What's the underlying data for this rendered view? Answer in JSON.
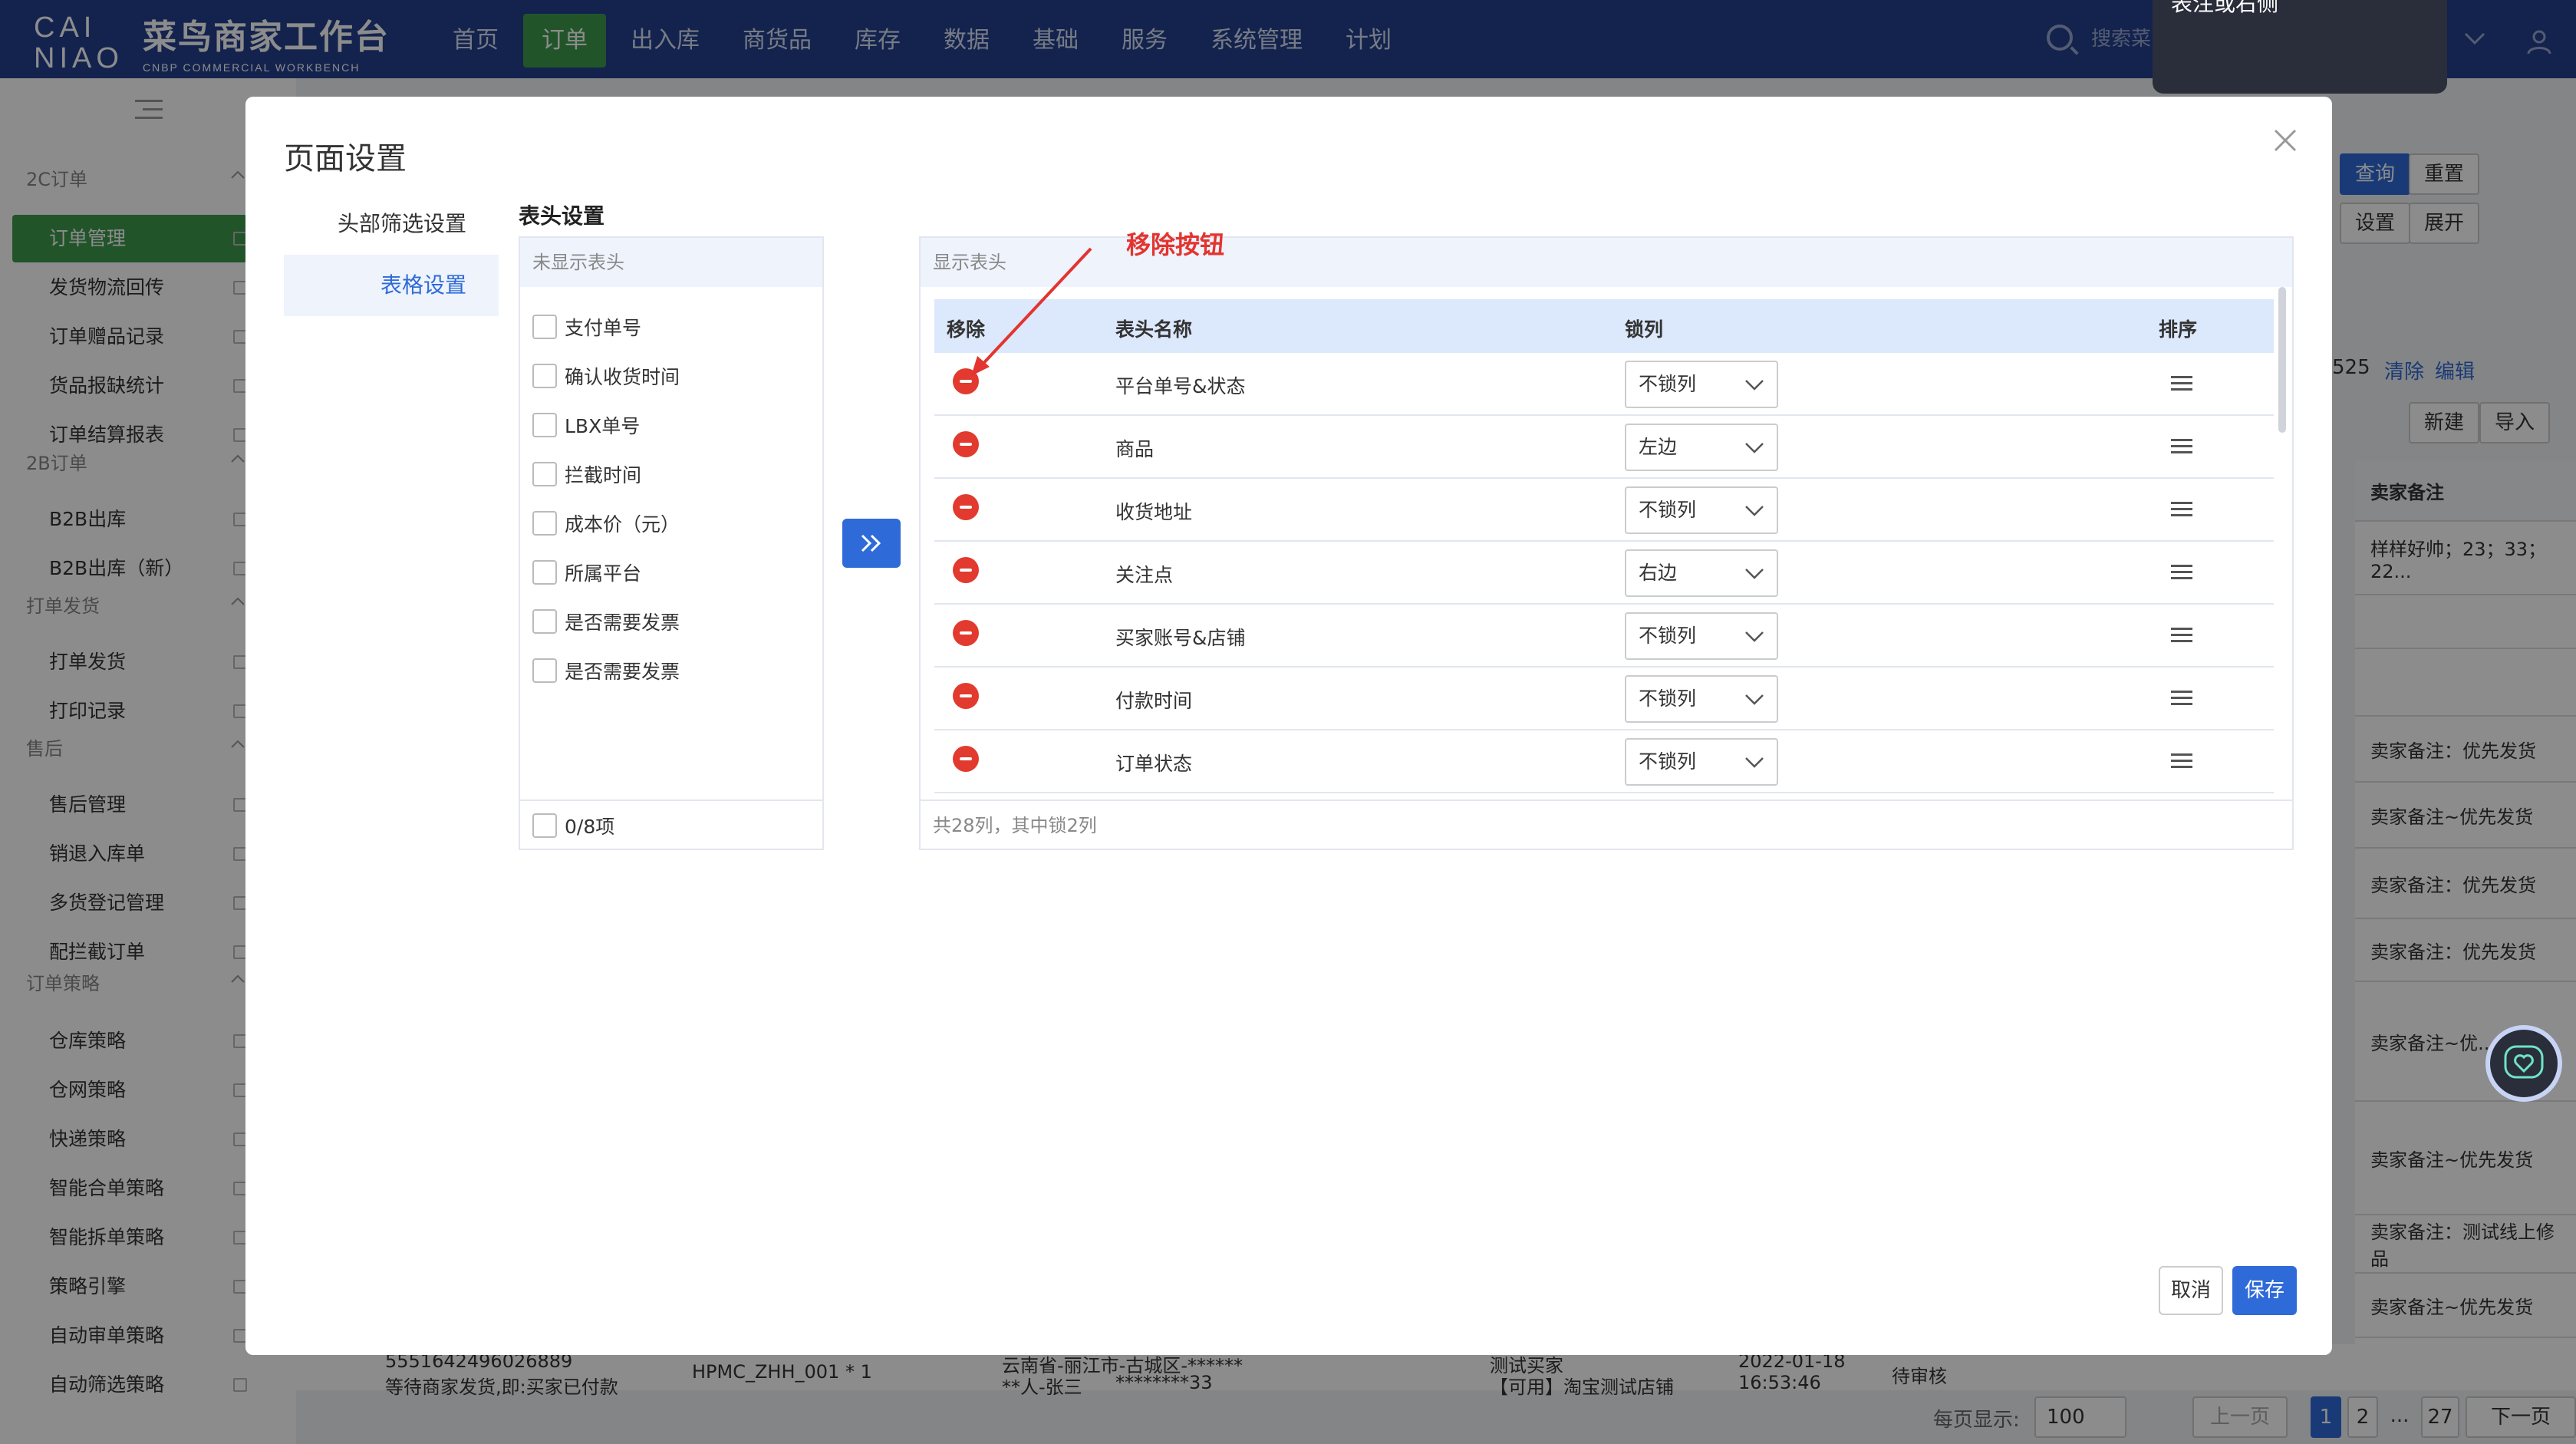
{
  "app": {
    "logo_text": "CAINIAO",
    "title": "菜鸟商家工作台",
    "subtitle": "CNBP COMMERCIAL WORKBENCH"
  },
  "nav": {
    "items": [
      {
        "label": "首页"
      },
      {
        "label": "订单"
      },
      {
        "label": "出入库"
      },
      {
        "label": "商货品"
      },
      {
        "label": "库存"
      },
      {
        "label": "数据"
      },
      {
        "label": "基础"
      },
      {
        "label": "服务"
      },
      {
        "label": "系统管理"
      },
      {
        "label": "计划"
      }
    ],
    "active_index": 1,
    "search_placeholder": "搜索菜",
    "tooltip_text": "表注或右侧"
  },
  "sidebar": {
    "groups": [
      {
        "label": "2C订单",
        "items": [
          "订单管理",
          "发货物流回传",
          "订单赠品记录",
          "货品报缺统计",
          "订单结算报表"
        ]
      },
      {
        "label": "2B订单",
        "items": [
          "B2B出库",
          "B2B出库（新）"
        ]
      },
      {
        "label": "打单发货",
        "items": [
          "打单发货",
          "打印记录"
        ]
      },
      {
        "label": "售后",
        "items": [
          "售后管理",
          "销退入库单",
          "多货登记管理",
          "配拦截订单"
        ]
      },
      {
        "label": "订单策略",
        "items": [
          "仓库策略",
          "仓网策略",
          "快递策略",
          "智能合单策略",
          "智能拆单策略",
          "策略引擎",
          "自动审单策略",
          "自动筛选策略"
        ]
      }
    ],
    "active_item": "订单管理"
  },
  "background": {
    "buttons": {
      "query": "查询",
      "reset": "重置",
      "settings": "设置",
      "expand": "展开",
      "new": "新建",
      "import": "导入"
    },
    "count_text": "525",
    "clear_link": "清除",
    "edit_link": "编辑",
    "seller_note_header": "卖家备注",
    "seller_notes": [
      "样样好帅；23；33；22...",
      "",
      "",
      "卖家备注：优先发货",
      "卖家备注~优先发货",
      "卖家备注：优先发货",
      "卖家备注：优先发货",
      "卖家备注~优...",
      "卖家备注~优先发货",
      "卖家备注：测试线上修品",
      "卖家备注~优先发货",
      "卖家备注~优先发货"
    ],
    "bottom_row": {
      "order_no": "5551642496026889",
      "order_sub": "等待商家发货,即:买家已付款",
      "product": "HPMC_ZHH_001 * 1",
      "address": "云南省-丽江市-古城区-******",
      "address_sub": "**人-张三",
      "phone": "********33",
      "buyer": "测试买家",
      "shop": "【可用】淘宝测试店铺",
      "date": "2022-01-18",
      "time": "16:53:46",
      "status": "待审核"
    },
    "pagination": {
      "per_page_label": "每页显示:",
      "per_page_value": "100",
      "prev": "上一页",
      "pages": [
        "1",
        "2",
        "...",
        "27"
      ],
      "next": "下一页"
    }
  },
  "modal": {
    "title": "页面设置",
    "tabs": [
      {
        "label": "头部筛选设置"
      },
      {
        "label": "表格设置"
      }
    ],
    "active_tab": 1,
    "section_title": "表头设置",
    "hidden_panel": {
      "title": "未显示表头",
      "items": [
        "支付单号",
        "确认收货时间",
        "LBX单号",
        "拦截时间",
        "成本价（元）",
        "所属平台",
        "是否需要发票",
        "是否需要发票"
      ],
      "footer": "0/8项"
    },
    "shown_panel": {
      "title": "显示表头",
      "columns": {
        "remove": "移除",
        "name": "表头名称",
        "lock": "锁列",
        "sort": "排序"
      },
      "rows": [
        {
          "name": "平台单号&状态",
          "lock": "不锁列"
        },
        {
          "name": "商品",
          "lock": "左边"
        },
        {
          "name": "收货地址",
          "lock": "不锁列"
        },
        {
          "name": "关注点",
          "lock": "右边"
        },
        {
          "name": "买家账号&店铺",
          "lock": "不锁列"
        },
        {
          "name": "付款时间",
          "lock": "不锁列"
        },
        {
          "name": "订单状态",
          "lock": "不锁列"
        }
      ],
      "footer": "共28列，其中锁2列"
    },
    "annotation": "移除按钮",
    "cancel_label": "取消",
    "save_label": "保存"
  },
  "colors": {
    "topbar": "#23408e",
    "nav_active": "#3e9a4e",
    "primary": "#2f6bd8",
    "remove_icon": "#e23a2e",
    "annotation": "#e3342f"
  }
}
